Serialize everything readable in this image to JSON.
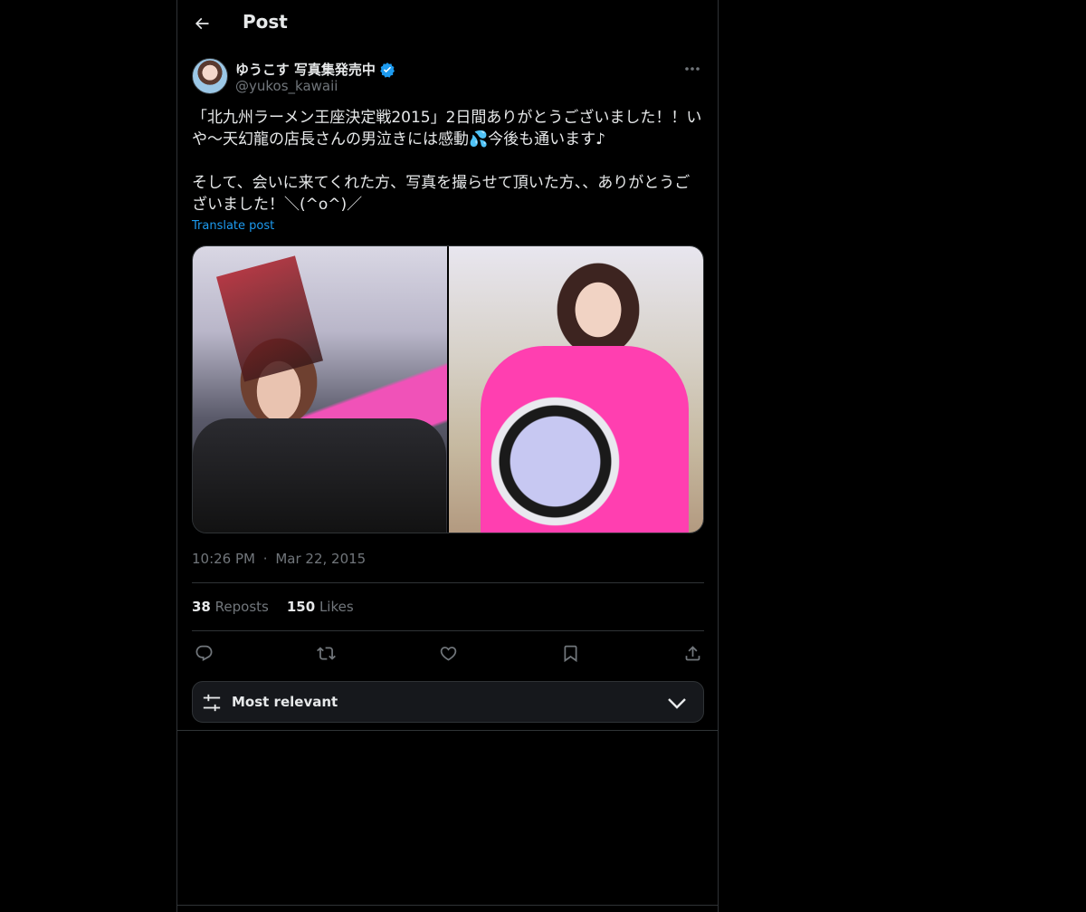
{
  "header": {
    "title": "Post",
    "back_icon": "arrow-left-icon"
  },
  "author": {
    "display_name": "ゆうこす 写真集発売中",
    "handle": "@yukos_kawaii",
    "verified": true,
    "verified_color": "#1d9bf0"
  },
  "post": {
    "text": "「北九州ラーメン王座決定戦2015」2日間ありがとうございました！！いや〜天幻龍の店長さんの男泣きには感動💦今後も通います♪\n\nそして、会いに来てくれた方、写真を撮らせて頂いた方、、ありがとうございました！＼(^o^)／",
    "translate_label": "Translate post",
    "media_count": 2,
    "time": "10:26 PM",
    "separator": "·",
    "date": "Mar 22, 2015"
  },
  "stats": {
    "reposts_count": "38",
    "reposts_label": "Reposts",
    "likes_count": "150",
    "likes_label": "Likes"
  },
  "actions": [
    "reply-icon",
    "repost-icon",
    "like-icon",
    "bookmark-icon",
    "share-icon"
  ],
  "sort": {
    "label": "Most relevant",
    "icon": "sliders-icon",
    "chevron": "chevron-down-icon"
  },
  "colors": {
    "background": "#000000",
    "text": "#e7e9ea",
    "muted": "#71767b",
    "accent": "#1d9bf0",
    "border": "#2f3336"
  }
}
